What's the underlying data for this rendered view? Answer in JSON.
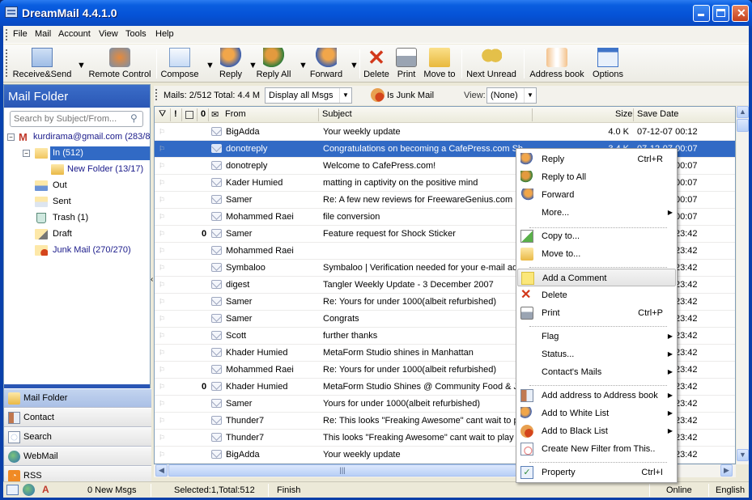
{
  "window": {
    "title": "DreamMail 4.4.1.0"
  },
  "menu": [
    "File",
    "Mail",
    "Account",
    "View",
    "Tools",
    "Help"
  ],
  "toolbar": {
    "receive_send": "Receive&Send",
    "remote_control": "Remote Control",
    "compose": "Compose",
    "reply": "Reply",
    "reply_all": "Reply All",
    "forward": "Forward",
    "delete": "Delete",
    "print": "Print",
    "move_to": "Move to",
    "next_unread": "Next Unread",
    "address_book": "Address book",
    "options": "Options"
  },
  "sidebar": {
    "header": "Mail Folder",
    "search_placeholder": "Search by Subject/From...",
    "account": "kurdirama@gmail.com (283/8",
    "folders": {
      "in": "In (512)",
      "new_folder": "New Folder (13/17)",
      "out": "Out",
      "sent": "Sent",
      "trash": "Trash (1)",
      "draft": "Draft",
      "junk": "Junk Mail (270/270)"
    },
    "nav": [
      "Mail Folder",
      "Contact",
      "Search",
      "WebMail",
      "RSS"
    ]
  },
  "mail_toolbar": {
    "summary": "Mails: 2/512 Total: 4.4 M",
    "display_filter": "Display all Msgs",
    "junk_button": "Is Junk Mail",
    "view_label": "View:",
    "view_value": "(None)"
  },
  "columns": {
    "from": "From",
    "subject": "Subject",
    "size": "Size",
    "save_date": "Save Date"
  },
  "mails": [
    {
      "from": "BigAdda",
      "subject": "Your weekly update",
      "size": "4.0 K",
      "date": "07-12-07 00:12",
      "attach": false,
      "selected": false
    },
    {
      "from": "donotreply",
      "subject": "Congratulations on becoming a CafePress.com Sh",
      "size": "3.4 K",
      "date": "07-12-07 00:07",
      "attach": false,
      "selected": true
    },
    {
      "from": "donotreply",
      "subject": "Welcome to CafePress.com!",
      "size": "",
      "date": "00:07",
      "attach": false,
      "selected": false
    },
    {
      "from": "Kader Humied",
      "subject": "matting in captivity on the positive mind",
      "size": "",
      "date": "00:07",
      "attach": false,
      "selected": false
    },
    {
      "from": "Samer",
      "subject": "Re: A few new reviews for FreewareGenius.com",
      "size": "",
      "date": "00:07",
      "attach": false,
      "selected": false
    },
    {
      "from": "Mohammed Raei",
      "subject": "file conversion",
      "size": "",
      "date": "00:07",
      "attach": false,
      "selected": false
    },
    {
      "from": "Samer",
      "subject": "Feature request for Shock Sticker",
      "size": "",
      "date": "23:42",
      "attach": true,
      "selected": false
    },
    {
      "from": "Mohammed Raei",
      "subject": "",
      "size": "",
      "date": "23:42",
      "attach": false,
      "selected": false
    },
    {
      "from": "Symbaloo",
      "subject": "Symbaloo | Verification needed for your e-mail add",
      "size": "",
      "date": "23:42",
      "attach": false,
      "selected": false
    },
    {
      "from": "digest",
      "subject": "Tangler Weekly Update - 3 December 2007",
      "size": "",
      "date": "23:42",
      "attach": false,
      "selected": false
    },
    {
      "from": "Samer",
      "subject": "Re: Yours for under 1000(albeit refurbished)",
      "size": "",
      "date": "23:42",
      "attach": false,
      "selected": false
    },
    {
      "from": "Samer",
      "subject": "Congrats",
      "size": "",
      "date": "23:42",
      "attach": false,
      "selected": false
    },
    {
      "from": "Scott",
      "subject": "further thanks",
      "size": "",
      "date": "23:42",
      "attach": false,
      "selected": false
    },
    {
      "from": "Khader Humied",
      "subject": "MetaForm Studio shines in Manhattan",
      "size": "",
      "date": "23:42",
      "attach": false,
      "selected": false
    },
    {
      "from": "Mohammed Raei",
      "subject": "Re: Yours for under 1000(albeit refurbished)",
      "size": "",
      "date": "23:42",
      "attach": false,
      "selected": false
    },
    {
      "from": "Khader Humied",
      "subject": "MetaForm Studio Shines @ Community Food & Ju",
      "size": "",
      "date": "23:42",
      "attach": true,
      "selected": false
    },
    {
      "from": "Samer",
      "subject": "Yours for under 1000(albeit refurbished)",
      "size": "",
      "date": "23:42",
      "attach": false,
      "selected": false
    },
    {
      "from": "Thunder7",
      "subject": "Re: This looks \"Freaking Awesome\" cant wait to p",
      "size": "",
      "date": "23:42",
      "attach": false,
      "selected": false
    },
    {
      "from": "Thunder7",
      "subject": "This looks \"Freaking Awesome\" cant wait to play",
      "size": "",
      "date": "23:42",
      "attach": false,
      "selected": false
    },
    {
      "from": "BigAdda",
      "subject": "Your weekly update",
      "size": "",
      "date": "23:42",
      "attach": false,
      "selected": false
    }
  ],
  "context_menu": {
    "reply": "Reply",
    "reply_sc": "Ctrl+R",
    "reply_all": "Reply to All",
    "forward": "Forward",
    "more": "More...",
    "copy_to": "Copy to...",
    "move_to": "Move to...",
    "add_comment": "Add a Comment",
    "delete": "Delete",
    "print": "Print",
    "print_sc": "Ctrl+P",
    "flag": "Flag",
    "status": "Status...",
    "contacts_mails": "Contact's Mails",
    "add_address": "Add address to Address book",
    "white_list": "Add to White List",
    "black_list": "Add to Black List",
    "new_filter": "Create New Filter from This..",
    "property": "Property",
    "property_sc": "Ctrl+I"
  },
  "statusbar": {
    "new_msgs": "0 New Msgs",
    "selection": "Selected:1,Total:512",
    "state": "Finish",
    "online": "Online",
    "language": "English"
  }
}
